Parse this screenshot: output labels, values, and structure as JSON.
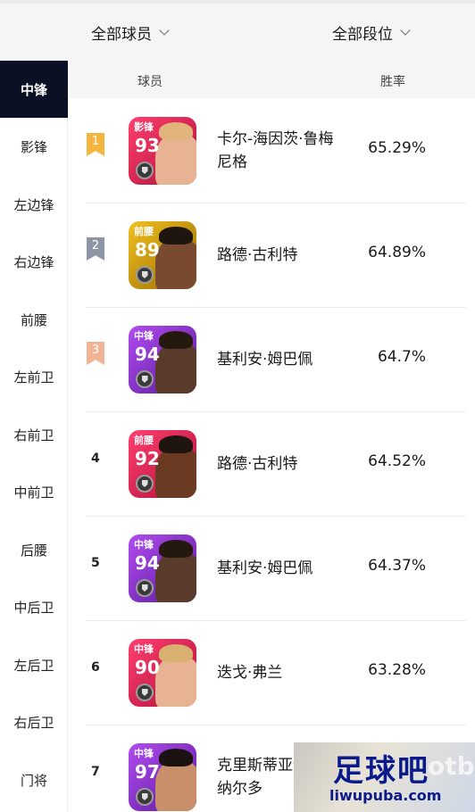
{
  "filters": {
    "player_filter": "全部球员",
    "tier_filter": "全部段位"
  },
  "sidebar": {
    "items": [
      {
        "label": "中锋",
        "active": true
      },
      {
        "label": "影锋",
        "active": false
      },
      {
        "label": "左边锋",
        "active": false
      },
      {
        "label": "右边锋",
        "active": false
      },
      {
        "label": "前腰",
        "active": false
      },
      {
        "label": "左前卫",
        "active": false
      },
      {
        "label": "右前卫",
        "active": false
      },
      {
        "label": "中前卫",
        "active": false
      },
      {
        "label": "后腰",
        "active": false
      },
      {
        "label": "中后卫",
        "active": false
      },
      {
        "label": "左后卫",
        "active": false
      },
      {
        "label": "右后卫",
        "active": false
      },
      {
        "label": "门将",
        "active": false
      }
    ]
  },
  "table": {
    "header_player": "球员",
    "header_rate": "胜率",
    "rows": [
      {
        "rank": "1",
        "position": "影锋",
        "rating": "93",
        "name": "卡尔-海因茨·鲁梅尼格",
        "win_rate": "65.29%",
        "card_color": "#d6204f",
        "badge_color": "#f4b63f"
      },
      {
        "rank": "2",
        "position": "前腰",
        "rating": "89",
        "name": "路德·古利特",
        "win_rate": "64.89%",
        "card_color": "#c79a12",
        "badge_color": "#8e96a6"
      },
      {
        "rank": "3",
        "position": "中锋",
        "rating": "94",
        "name": "基利安·姆巴佩",
        "win_rate": "64.7%",
        "card_color": "#8a2fd0",
        "badge_color": "#f1b394"
      },
      {
        "rank": "4",
        "position": "前腰",
        "rating": "92",
        "name": "路德·古利特",
        "win_rate": "64.52%",
        "card_color": "#d6204f",
        "badge_color": ""
      },
      {
        "rank": "5",
        "position": "中锋",
        "rating": "94",
        "name": "基利安·姆巴佩",
        "win_rate": "64.37%",
        "card_color": "#8a2fd0",
        "badge_color": ""
      },
      {
        "rank": "6",
        "position": "中锋",
        "rating": "90",
        "name": "迭戈·弗兰",
        "win_rate": "63.28%",
        "card_color": "#d6204f",
        "badge_color": ""
      },
      {
        "rank": "7",
        "position": "中锋",
        "rating": "97",
        "name": "克里斯蒂亚诺·罗纳尔多",
        "win_rate": "",
        "card_color": "#8a2fd0",
        "badge_color": ""
      }
    ]
  },
  "watermark": {
    "main": "足球吧",
    "url": "liwupuba.com",
    "bg": "otba"
  }
}
